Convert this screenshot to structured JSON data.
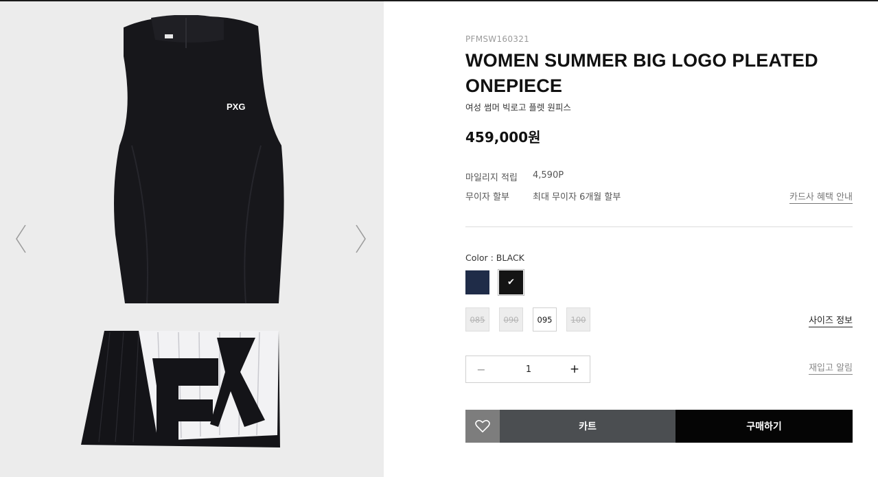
{
  "product": {
    "sku": "PFMSW160321",
    "title": "WOMEN SUMMER BIG LOGO PLEATED ONEPIECE",
    "subtitle": "여성 썸머 빅로고 플렛 원피스",
    "price": "459,000원",
    "image_logo_text": "PXG"
  },
  "benefits": {
    "mileage_label": "마일리지 적립",
    "mileage_value": "4,590P",
    "installment_label": "무이자 할부",
    "installment_value": "최대 무이자 6개월 할부",
    "card_benefit_link": "카드사 혜택 안내"
  },
  "color": {
    "label": "Color : BLACK",
    "swatches": [
      {
        "name": "navy",
        "hex": "#1f2c48",
        "selected": false
      },
      {
        "name": "black",
        "hex": "#141414",
        "selected": true
      }
    ],
    "check_mark": "✔"
  },
  "sizes": {
    "options": [
      {
        "label": "085",
        "available": false
      },
      {
        "label": "090",
        "available": false
      },
      {
        "label": "095",
        "available": true
      },
      {
        "label": "100",
        "available": false
      }
    ],
    "size_info_link": "사이즈 정보"
  },
  "quantity": {
    "minus": "−",
    "value": "1",
    "plus": "+",
    "restock_link": "재입고 알림"
  },
  "actions": {
    "cart_label": "카트",
    "buy_label": "구매하기"
  },
  "icons": {
    "prev": "chevron-left-icon",
    "next": "chevron-right-icon",
    "wishlist": "heart-icon"
  },
  "colors": {
    "gallery_bg": "#ececec",
    "cart_bg": "#4b4e51",
    "buy_bg": "#050505",
    "wish_bg": "#7d7d7d"
  }
}
